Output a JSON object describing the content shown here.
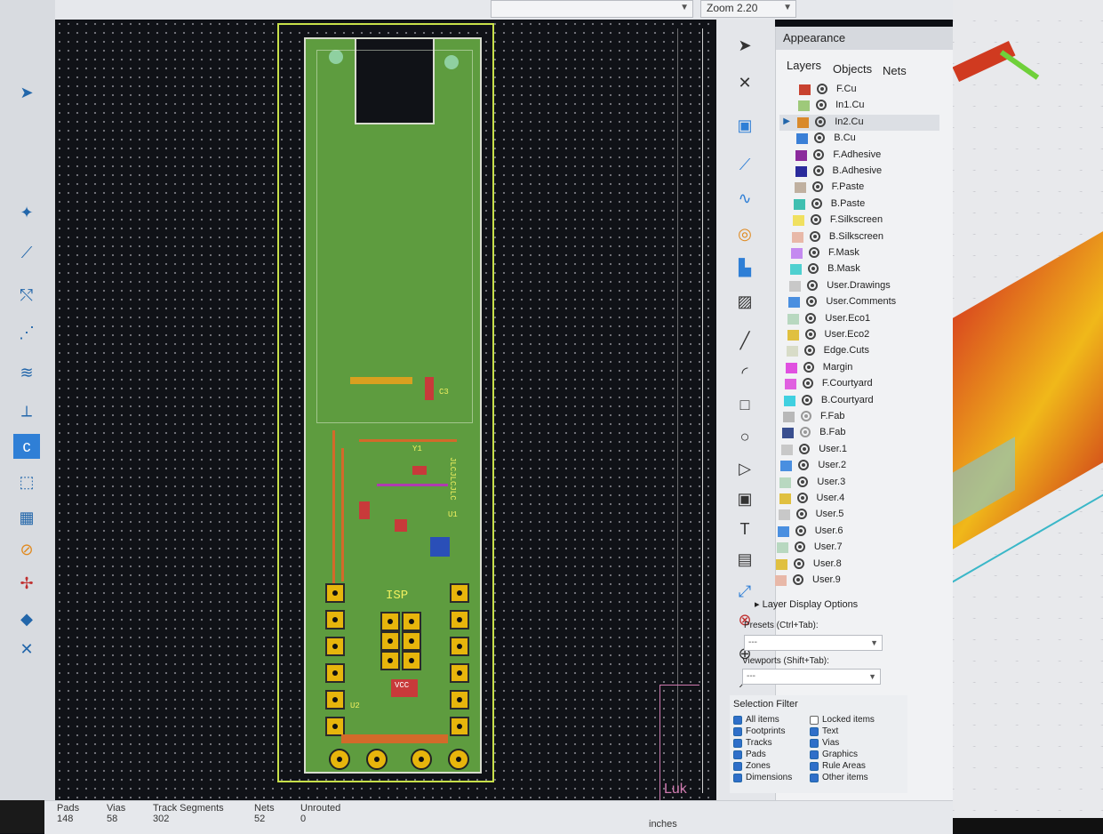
{
  "top_bar": {
    "grid_label": "",
    "zoom_label": "Zoom 2.20"
  },
  "left_toolbar": {
    "icons": [
      "layer-icon",
      "cursor-icon",
      "netlist-icon",
      "measure-icon",
      "route-icon",
      "ratsnest-icon",
      "diff-pair-icon",
      "tune-icon",
      "drc-icon",
      "footprint-icon",
      "copper-zone-icon",
      "graphic-icon",
      "highlight-icon",
      "3d-icon",
      "tools-icon"
    ]
  },
  "board": {
    "silkscreen": [
      "ISP",
      "U2",
      "VCC",
      "Y1",
      "U1",
      "C3",
      "JLCJLCJLC"
    ]
  },
  "canvas": {
    "corner_text": "Luk"
  },
  "appearance": {
    "title": "Appearance",
    "tabs": [
      "Layers",
      "Objects",
      "Nets"
    ],
    "layers": [
      {
        "name": "F.Cu",
        "color": "#c8412f",
        "visible": true
      },
      {
        "name": "In1.Cu",
        "color": "#9ec97a",
        "visible": true
      },
      {
        "name": "In2.Cu",
        "color": "#d98a2b",
        "visible": true,
        "selected": true
      },
      {
        "name": "B.Cu",
        "color": "#3a7fd6",
        "visible": true
      },
      {
        "name": "F.Adhesive",
        "color": "#8b2a9c",
        "visible": true
      },
      {
        "name": "B.Adhesive",
        "color": "#2a2a9c",
        "visible": true
      },
      {
        "name": "F.Paste",
        "color": "#c0b0a0",
        "visible": true
      },
      {
        "name": "B.Paste",
        "color": "#3fbfb0",
        "visible": true
      },
      {
        "name": "F.Silkscreen",
        "color": "#f0e060",
        "visible": true
      },
      {
        "name": "B.Silkscreen",
        "color": "#e8b8a8",
        "visible": true
      },
      {
        "name": "F.Mask",
        "color": "#c48af0",
        "visible": true
      },
      {
        "name": "B.Mask",
        "color": "#4fd0d0",
        "visible": true
      },
      {
        "name": "User.Drawings",
        "color": "#c8c8c8",
        "visible": true
      },
      {
        "name": "User.Comments",
        "color": "#4a8fe0",
        "visible": true
      },
      {
        "name": "User.Eco1",
        "color": "#b8d8c0",
        "visible": true
      },
      {
        "name": "User.Eco2",
        "color": "#e0c040",
        "visible": true
      },
      {
        "name": "Edge.Cuts",
        "color": "#d8dcc8",
        "visible": true
      },
      {
        "name": "Margin",
        "color": "#e050e0",
        "visible": true
      },
      {
        "name": "F.Courtyard",
        "color": "#e060e0",
        "visible": true
      },
      {
        "name": "B.Courtyard",
        "color": "#40d0e0",
        "visible": true
      },
      {
        "name": "F.Fab",
        "color": "#b8b8b8",
        "visible": false
      },
      {
        "name": "B.Fab",
        "color": "#3a4f8f",
        "visible": false
      },
      {
        "name": "User.1",
        "color": "#c8c8c8",
        "visible": true
      },
      {
        "name": "User.2",
        "color": "#4a8fe0",
        "visible": true
      },
      {
        "name": "User.3",
        "color": "#b8d8c0",
        "visible": true
      },
      {
        "name": "User.4",
        "color": "#e0c040",
        "visible": true
      },
      {
        "name": "User.5",
        "color": "#c8c8c8",
        "visible": true
      },
      {
        "name": "User.6",
        "color": "#4a8fe0",
        "visible": true
      },
      {
        "name": "User.7",
        "color": "#b8d8c0",
        "visible": true
      },
      {
        "name": "User.8",
        "color": "#e0c040",
        "visible": true
      },
      {
        "name": "User.9",
        "color": "#e8b8a8",
        "visible": true
      }
    ],
    "layer_display_options": "Layer Display Options",
    "presets_label": "Presets (Ctrl+Tab):",
    "presets_value": "---",
    "viewports_label": "Viewports (Shift+Tab):",
    "viewports_value": "---"
  },
  "selection_filter": {
    "title": "Selection Filter",
    "items": [
      {
        "label": "All items",
        "checked": true
      },
      {
        "label": "Locked items",
        "checked": false
      },
      {
        "label": "Footprints",
        "checked": true
      },
      {
        "label": "Text",
        "checked": true
      },
      {
        "label": "Tracks",
        "checked": true
      },
      {
        "label": "Vias",
        "checked": true
      },
      {
        "label": "Pads",
        "checked": true
      },
      {
        "label": "Graphics",
        "checked": true
      },
      {
        "label": "Zones",
        "checked": true
      },
      {
        "label": "Rule Areas",
        "checked": true
      },
      {
        "label": "Dimensions",
        "checked": true
      },
      {
        "label": "Other items",
        "checked": true
      }
    ]
  },
  "status_bar": {
    "pads_label": "Pads",
    "pads_value": "148",
    "vias_label": "Vias",
    "vias_value": "58",
    "tracks_label": "Track Segments",
    "tracks_value": "302",
    "nets_label": "Nets",
    "nets_value": "52",
    "unrouted_label": "Unrouted",
    "unrouted_value": "0",
    "units": "inches"
  }
}
